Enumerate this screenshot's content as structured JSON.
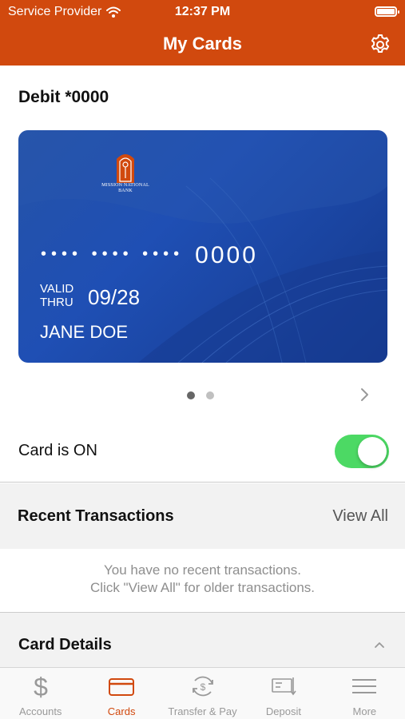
{
  "status_bar": {
    "carrier": "Service Provider",
    "time": "12:37 PM"
  },
  "header": {
    "title": "My Cards"
  },
  "card": {
    "name": "Debit *0000",
    "bank_name": "MISSION NATIONAL BANK",
    "masked_groups": "•••• •••• ••••",
    "last_four": "0000",
    "valid_thru_line1": "VALID",
    "valid_thru_line2": "THRU",
    "expiry": "09/28",
    "holder": "JANE DOE",
    "pager_count": 2,
    "pager_active": 0
  },
  "toggle": {
    "label": "Card is ON",
    "on": true
  },
  "transactions": {
    "title": "Recent Transactions",
    "view_all_label": "View All",
    "empty_line1": "You have no recent transactions.",
    "empty_line2": "Click \"View All\" for older transactions."
  },
  "card_details": {
    "title": "Card Details"
  },
  "tabbar": {
    "tabs": [
      {
        "label": "Accounts",
        "icon": "dollar-icon",
        "active": false
      },
      {
        "label": "Cards",
        "icon": "card-icon",
        "active": true
      },
      {
        "label": "Transfer & Pay",
        "icon": "transfer-icon",
        "active": false
      },
      {
        "label": "Deposit",
        "icon": "deposit-icon",
        "active": false
      },
      {
        "label": "More",
        "icon": "menu-icon",
        "active": false
      }
    ]
  },
  "colors": {
    "brand": "#d1490e",
    "toggle_on": "#4cd964",
    "card_blue": "#1f4fb4"
  }
}
